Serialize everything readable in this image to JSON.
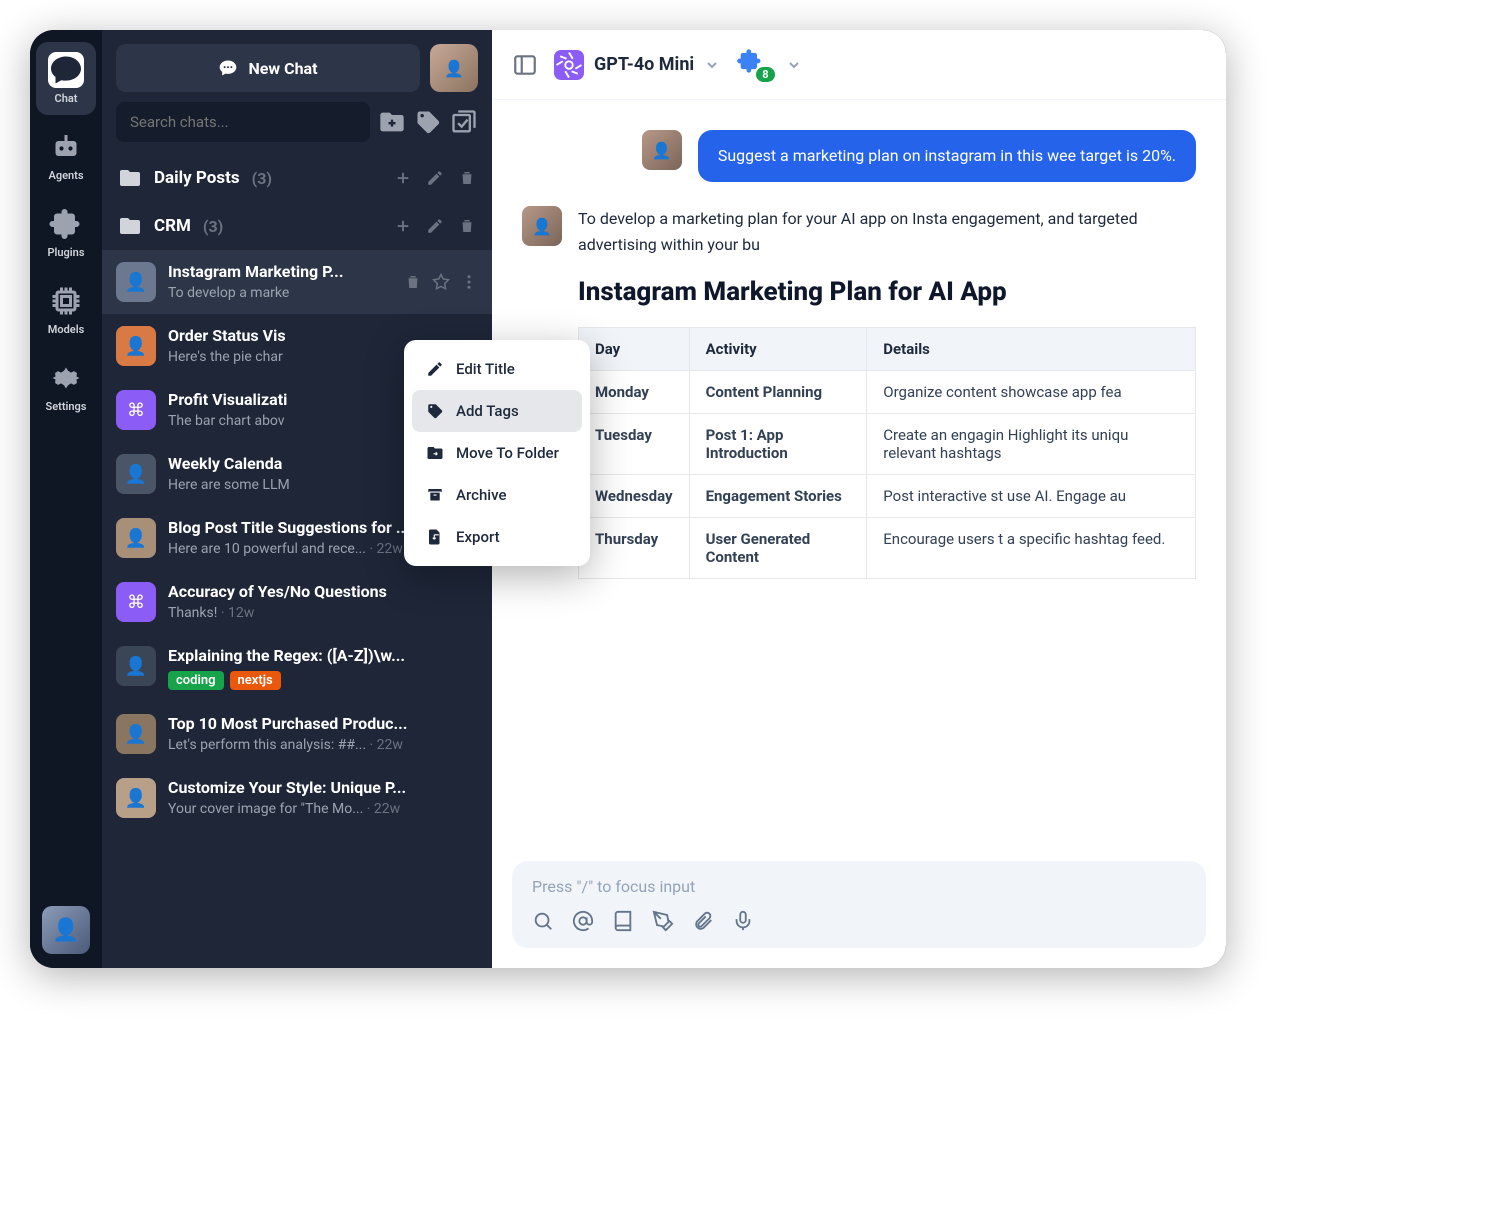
{
  "nav": {
    "items": [
      {
        "label": "Chat",
        "icon": "chat"
      },
      {
        "label": "Agents",
        "icon": "robot"
      },
      {
        "label": "Plugins",
        "icon": "puzzle"
      },
      {
        "label": "Models",
        "icon": "chip"
      },
      {
        "label": "Settings",
        "icon": "gear"
      }
    ]
  },
  "sidebar": {
    "new_chat_label": "New Chat",
    "search_placeholder": "Search chats...",
    "folders": [
      {
        "name": "Daily Posts",
        "count": "(3)"
      },
      {
        "name": "CRM",
        "count": "(3)"
      }
    ],
    "chats": [
      {
        "title": "Instagram Marketing P...",
        "preview": "To develop a marke",
        "thumb_color": "#6b7890",
        "selected": true,
        "show_actions": true
      },
      {
        "title": "Order Status Vis",
        "preview": "Here's the pie char",
        "thumb_color": "#d97a45"
      },
      {
        "title": "Profit Visualizati",
        "preview": "The bar chart abov",
        "thumb_color": "#8b5cf6",
        "thumb_glyph": "⌘"
      },
      {
        "title": "Weekly Calenda",
        "preview": "Here are some LLM",
        "thumb_color": "#4a5568"
      },
      {
        "title": "Blog Post Title Suggestions for ...",
        "preview": "Here are 10 powerful and rece...",
        "meta": "22w",
        "thumb_color": "#a89078"
      },
      {
        "title": "Accuracy of Yes/No Questions",
        "preview": "Thanks!",
        "meta": "12w",
        "thumb_color": "#8b5cf6",
        "thumb_glyph": "⌘"
      },
      {
        "title": "Explaining the Regex: ([A-Z])\\w...",
        "tags": [
          "coding",
          "nextjs"
        ],
        "thumb_color": "#3a4555"
      },
      {
        "title": "Top 10 Most Purchased Produc...",
        "preview": "Let's perform this analysis: ##...",
        "meta": "22w",
        "thumb_color": "#8a7560"
      },
      {
        "title": "Customize Your Style: Unique P...",
        "preview": "Your cover image for \"The Mo...",
        "meta": "22w",
        "thumb_color": "#b8a088"
      }
    ]
  },
  "context_menu": {
    "items": [
      {
        "label": "Edit Title",
        "icon": "pencil"
      },
      {
        "label": "Add Tags",
        "icon": "tag",
        "hover": true
      },
      {
        "label": "Move To Folder",
        "icon": "folder-move"
      },
      {
        "label": "Archive",
        "icon": "archive"
      },
      {
        "label": "Export",
        "icon": "export"
      }
    ]
  },
  "header": {
    "model": "GPT-4o Mini",
    "plugin_count": "8"
  },
  "conversation": {
    "user_msg": "Suggest a marketing plan on instagram in this wee target is 20%.",
    "ai_msg": "To develop a marketing plan for your AI app on Insta engagement, and targeted advertising within your bu",
    "heading": "Instagram Marketing Plan for AI App",
    "table": {
      "headers": [
        "Day",
        "Activity",
        "Details"
      ],
      "rows": [
        [
          "Monday",
          "Content Planning",
          "Organize content showcase app fea"
        ],
        [
          "Tuesday",
          "Post 1: App Introduction",
          "Create an engagin Highlight its uniqu relevant hashtags"
        ],
        [
          "Wednesday",
          "Engagement Stories",
          "Post interactive st use AI. Engage au"
        ],
        [
          "Thursday",
          "User Generated Content",
          "Encourage users t a specific hashtag feed."
        ]
      ]
    }
  },
  "input": {
    "placeholder": "Press \"/\" to focus input"
  }
}
